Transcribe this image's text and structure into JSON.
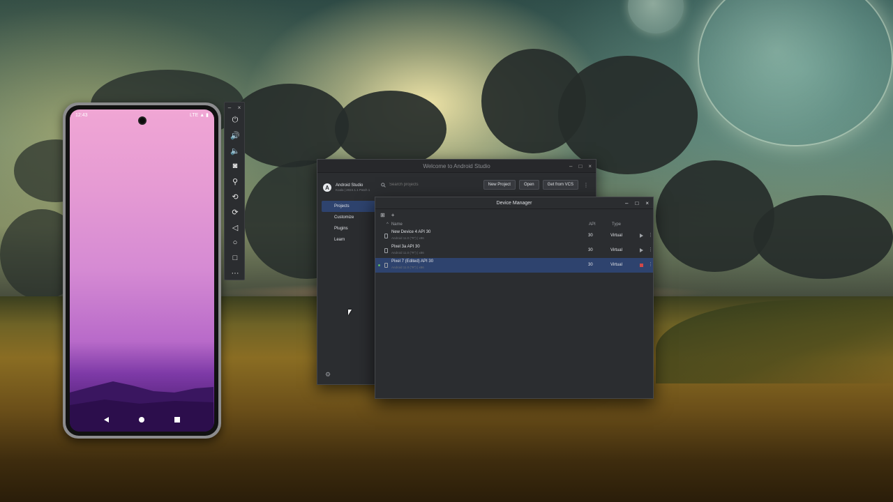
{
  "emulator": {
    "status_time": "12:43",
    "status_right": "LTE ▲ ▮",
    "toolbar": {
      "minimize": "–",
      "close": "×",
      "buttons": [
        {
          "icon": "power-icon",
          "glyph": "⏻"
        },
        {
          "icon": "volume-up-icon",
          "glyph": "🔊"
        },
        {
          "icon": "volume-down-icon",
          "glyph": "🔈"
        },
        {
          "icon": "camera-icon",
          "glyph": "◙"
        },
        {
          "icon": "zoom-icon",
          "glyph": "⚲"
        },
        {
          "icon": "rotate-left-icon",
          "glyph": "⟲"
        },
        {
          "icon": "rotate-right-icon",
          "glyph": "⟳"
        },
        {
          "icon": "back-icon",
          "glyph": "◁"
        },
        {
          "icon": "home-icon",
          "glyph": "○"
        },
        {
          "icon": "overview-icon",
          "glyph": "□"
        },
        {
          "icon": "more-icon",
          "glyph": "···"
        }
      ]
    }
  },
  "welcome": {
    "title": "Welcome to Android Studio",
    "controls": {
      "minimize": "–",
      "maximize": "□",
      "close": "×"
    },
    "brand": {
      "logo_letter": "A",
      "name": "Android Studio",
      "version": "Koala | 2024.1.1 Patch 1"
    },
    "sidebar": {
      "items": [
        {
          "label": "Projects",
          "active": true
        },
        {
          "label": "Customize",
          "active": false
        },
        {
          "label": "Plugins",
          "active": false
        },
        {
          "label": "Learn",
          "active": false
        }
      ],
      "settings_icon": "⚙"
    },
    "toolbar": {
      "search_placeholder": "Search projects",
      "new_project": "New Project",
      "open": "Open",
      "get_from_vcs": "Get from VCS",
      "more": "⋮"
    }
  },
  "device_manager": {
    "title": "Device Manager",
    "controls": {
      "minimize": "–",
      "maximize": "□",
      "close": "×"
    },
    "tools": {
      "layout_icon": "⊞",
      "add_icon": "+"
    },
    "columns": {
      "name": "Name",
      "api": "API",
      "type": "Type",
      "sort_indicator": "^"
    },
    "devices": [
      {
        "name": "New Device 4 API 30",
        "sub": "Android 11.0 (\"R\") | x86",
        "api": "30",
        "type": "Virtual",
        "running": false,
        "selected": false
      },
      {
        "name": "Pixel 3a API 30",
        "sub": "Android 11.0 (\"R\") | x86",
        "api": "30",
        "type": "Virtual",
        "running": false,
        "selected": false
      },
      {
        "name": "Pixel 7 (Edited) API 30",
        "sub": "Android 11.0 (\"R\") | x86",
        "api": "30",
        "type": "Virtual",
        "running": true,
        "selected": true
      }
    ],
    "row_more": "⋮"
  }
}
